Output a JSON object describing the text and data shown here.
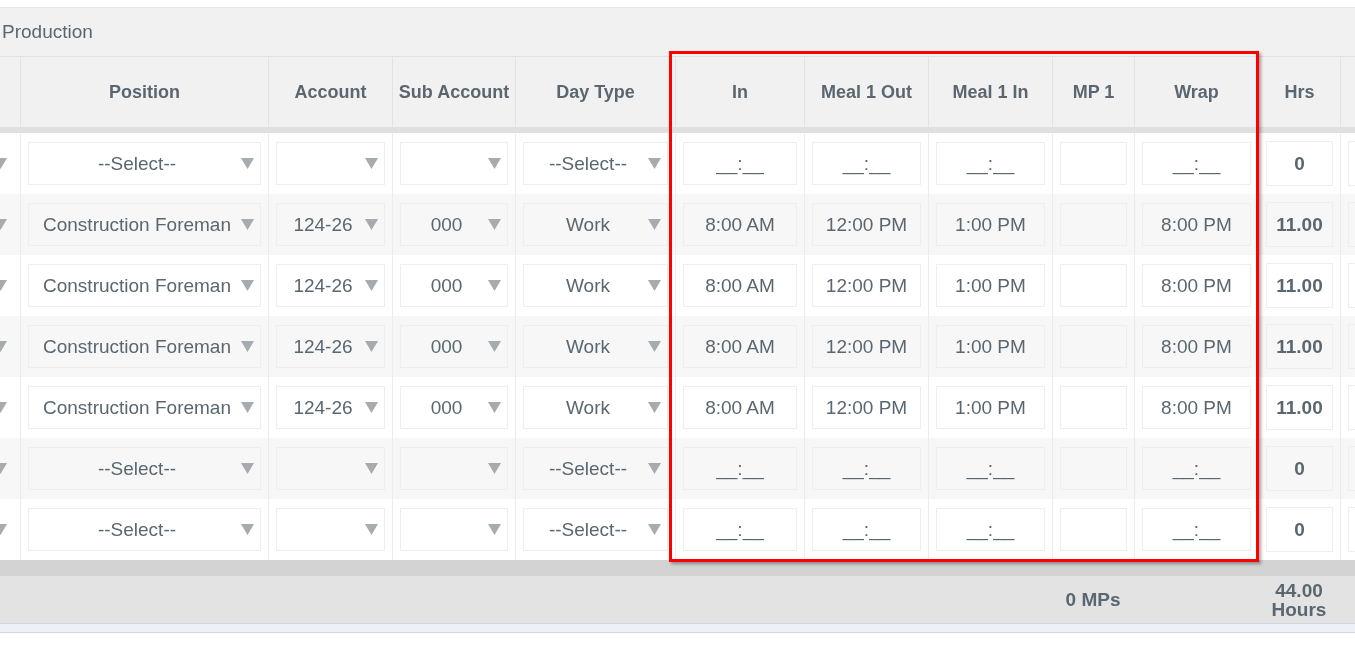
{
  "section": {
    "title": "Production"
  },
  "columns": [
    "Position",
    "Account",
    "Sub Account",
    "Day Type",
    "In",
    "Meal 1 Out",
    "Meal 1 In",
    "MP 1",
    "Wrap",
    "Hrs"
  ],
  "rows": [
    {
      "position": "--Select--",
      "day_type": "--Select--",
      "times": {
        "in": {
          "placeholder": "__:__"
        },
        "meal_1_out": {
          "placeholder": "__:__"
        },
        "meal_1_in": {
          "placeholder": "__:__"
        },
        "wrap": {
          "placeholder": "__:__"
        }
      },
      "hrs": "0"
    },
    {
      "position": "Construction Foreman",
      "account": "124-26",
      "sub_account": "000",
      "day_type": "Work",
      "times": {
        "in": {
          "value": "8:00 AM"
        },
        "meal_1_out": {
          "value": "12:00 PM"
        },
        "meal_1_in": {
          "value": "1:00 PM"
        },
        "wrap": {
          "value": "8:00 PM"
        }
      },
      "hrs": "11.00"
    },
    {
      "position": "Construction Foreman",
      "account": "124-26",
      "sub_account": "000",
      "day_type": "Work",
      "times": {
        "in": {
          "value": "8:00 AM"
        },
        "meal_1_out": {
          "value": "12:00 PM"
        },
        "meal_1_in": {
          "value": "1:00 PM"
        },
        "wrap": {
          "value": "8:00 PM"
        }
      },
      "hrs": "11.00"
    },
    {
      "position": "Construction Foreman",
      "account": "124-26",
      "sub_account": "000",
      "day_type": "Work",
      "times": {
        "in": {
          "value": "8:00 AM"
        },
        "meal_1_out": {
          "value": "12:00 PM"
        },
        "meal_1_in": {
          "value": "1:00 PM"
        },
        "wrap": {
          "value": "8:00 PM"
        }
      },
      "hrs": "11.00"
    },
    {
      "position": "Construction Foreman",
      "account": "124-26",
      "sub_account": "000",
      "day_type": "Work",
      "times": {
        "in": {
          "value": "8:00 AM"
        },
        "meal_1_out": {
          "value": "12:00 PM"
        },
        "meal_1_in": {
          "value": "1:00 PM"
        },
        "wrap": {
          "value": "8:00 PM"
        }
      },
      "hrs": "11.00"
    },
    {
      "position": "--Select--",
      "day_type": "--Select--",
      "times": {
        "in": {
          "placeholder": "__:__"
        },
        "meal_1_out": {
          "placeholder": "__:__"
        },
        "meal_1_in": {
          "placeholder": "__:__"
        },
        "wrap": {
          "placeholder": "__:__"
        }
      },
      "hrs": "0"
    },
    {
      "position": "--Select--",
      "day_type": "--Select--",
      "times": {
        "in": {
          "placeholder": "__:__"
        },
        "meal_1_out": {
          "placeholder": "__:__"
        },
        "meal_1_in": {
          "placeholder": "__:__"
        },
        "wrap": {
          "placeholder": "__:__"
        }
      },
      "hrs": "0"
    }
  ],
  "totals": {
    "mps": "0 MPs",
    "hours": "44.00 Hours"
  }
}
